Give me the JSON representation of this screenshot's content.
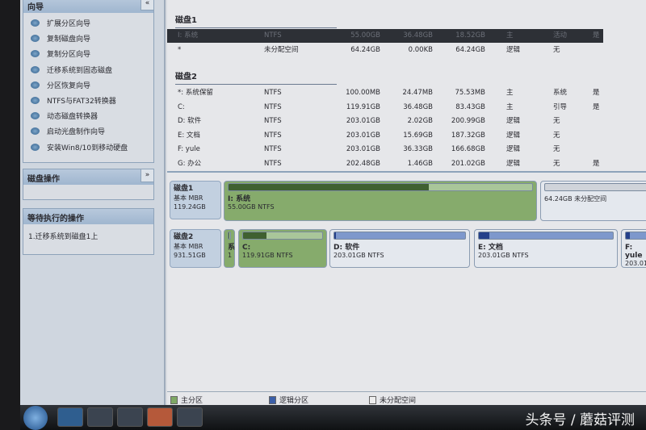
{
  "sidebar": {
    "wizard_title": "向导",
    "wizard_items": [
      "扩展分区向导",
      "复制磁盘向导",
      "复制分区向导",
      "迁移系统到固态磁盘",
      "分区恢复向导",
      "NTFS与FAT32转换器",
      "动态磁盘转换器",
      "启动光盘制作向导",
      "安装Win8/10到移动硬盘"
    ],
    "disk_ops_title": "磁盘操作",
    "pending_title": "等待执行的操作",
    "pending_items": [
      "1.迁移系统到磁盘1上"
    ]
  },
  "table": {
    "disk1": {
      "title": "磁盘1",
      "rows": [
        [
          "I: 系统",
          "NTFS",
          "55.00GB",
          "36.48GB",
          "18.52GB",
          "主",
          "活动",
          "是"
        ],
        [
          "*",
          "未分配空间",
          "64.24GB",
          "0.00KB",
          "64.24GB",
          "逻辑",
          "无",
          ""
        ]
      ]
    },
    "disk2": {
      "title": "磁盘2",
      "rows": [
        [
          "*: 系统保留",
          "NTFS",
          "100.00MB",
          "24.47MB",
          "75.53MB",
          "主",
          "系统",
          "是"
        ],
        [
          "C:",
          "NTFS",
          "119.91GB",
          "36.48GB",
          "83.43GB",
          "主",
          "引导",
          "是"
        ],
        [
          "D: 软件",
          "NTFS",
          "203.01GB",
          "2.02GB",
          "200.99GB",
          "逻辑",
          "无",
          ""
        ],
        [
          "E: 文档",
          "NTFS",
          "203.01GB",
          "15.69GB",
          "187.32GB",
          "逻辑",
          "无",
          ""
        ],
        [
          "F: yule",
          "NTFS",
          "203.01GB",
          "36.33GB",
          "166.68GB",
          "逻辑",
          "无",
          ""
        ],
        [
          "G: 办公",
          "NTFS",
          "202.48GB",
          "1.46GB",
          "201.02GB",
          "逻辑",
          "无",
          "是"
        ]
      ]
    }
  },
  "map": {
    "disk1": {
      "name": "磁盘1",
      "type": "基本 MBR",
      "size": "119.24GB",
      "parts": [
        {
          "name": "I: 系统",
          "info": "55.00GB NTFS",
          "used_pct": 66
        },
        {
          "name": "",
          "info": "64.24GB 未分配空间",
          "used_pct": 0
        }
      ]
    },
    "disk2": {
      "name": "磁盘2",
      "type": "基本 MBR",
      "size": "931.51GB",
      "parts": [
        {
          "name": "系",
          "info": "1",
          "used_pct": 24
        },
        {
          "name": "C:",
          "info": "119.91GB NTFS",
          "used_pct": 30
        },
        {
          "name": "D: 软件",
          "info": "203.01GB NTFS",
          "used_pct": 1
        },
        {
          "name": "E: 文档",
          "info": "203.01GB NTFS",
          "used_pct": 8
        },
        {
          "name": "F: yule",
          "info": "203.01",
          "used_pct": 18
        }
      ]
    }
  },
  "legend": {
    "primary": "主分区",
    "logical": "逻辑分区",
    "unallocated": "未分配空间"
  },
  "colors": {
    "primary": "#7fa865",
    "logical": "#3b5fa8",
    "selected_row": "#2d3036"
  },
  "watermark": "头条号 / 蘑菇评测"
}
